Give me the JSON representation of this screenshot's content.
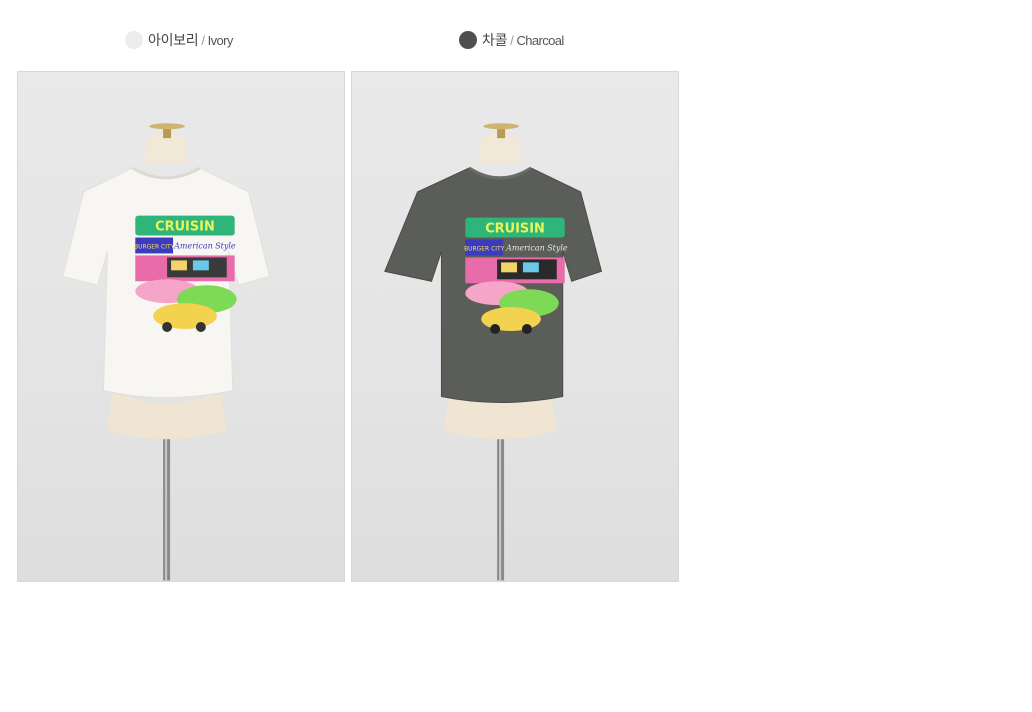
{
  "colors": [
    {
      "id": "ivory",
      "swatch": "#ececec",
      "label_ko": "아이보리",
      "separator": "/",
      "label_en": "Ivory",
      "shirt": "#f7f6f2"
    },
    {
      "id": "charcoal",
      "swatch": "#4f4f4f",
      "label_ko": "차콜",
      "separator": "/",
      "label_en": "Charcoal",
      "shirt": "#5b5d59"
    }
  ],
  "print": {
    "title": "CRUISIN",
    "sub_left": "BURGER CITY",
    "sub_right": "American Style"
  }
}
